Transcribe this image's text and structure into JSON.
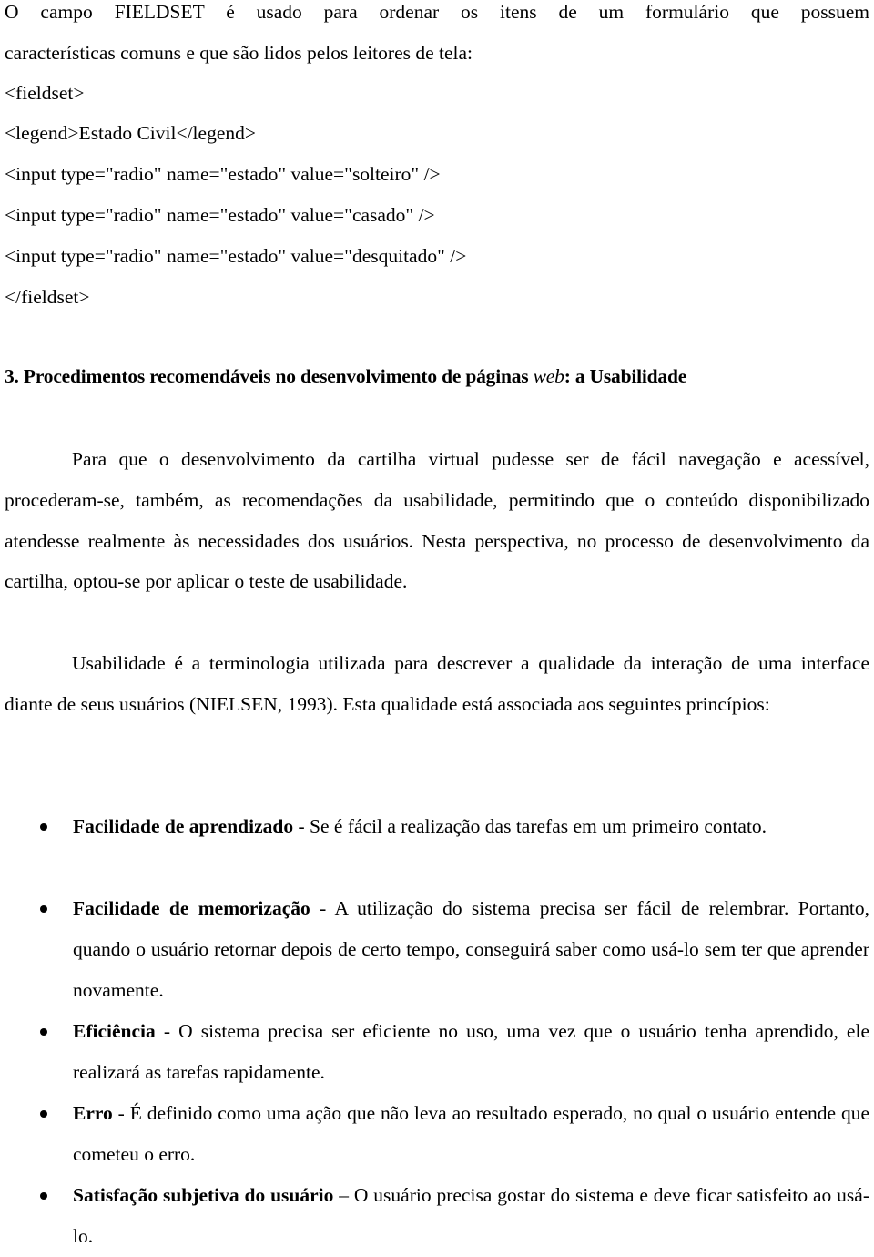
{
  "intro": {
    "line1": "O campo FIELDSET é usado para ordenar os itens de um formulário que possuem",
    "line2": "características comuns e que são lidos pelos leitores de tela:"
  },
  "code": [
    "<fieldset>",
    "<legend>Estado Civil</legend>",
    "<input type=\"radio\" name=\"estado\" value=\"solteiro\" />",
    "<input type=\"radio\" name=\"estado\" value=\"casado\" />",
    "<input type=\"radio\" name=\"estado\" value=\"desquitado\" />",
    "</fieldset>"
  ],
  "section": {
    "number_title": "3. Procedimentos recomendáveis no desenvolvimento de páginas",
    "italic_word": "web",
    "title_tail": ": a Usabilidade"
  },
  "paragraphs": [
    "Para que o desenvolvimento da cartilha virtual pudesse ser de fácil navegação e acessível, procederam-se, também, as recomendações da usabilidade, permitindo que o conteúdo disponibilizado atendesse realmente às necessidades dos usuários. Nesta perspectiva, no processo de desenvolvimento da cartilha, optou-se por aplicar o teste de usabilidade.",
    "Usabilidade é a terminologia utilizada para descrever a qualidade da interação de uma interface diante de seus usuários (NIELSEN, 1993). Esta qualidade está associada aos seguintes princípios:"
  ],
  "principles": [
    {
      "term": "Facilidade de aprendizado",
      "separator": " - ",
      "text": "Se é fácil a realização das tarefas em um primeiro contato."
    },
    {
      "term": "Facilidade de memorização",
      "separator": " - ",
      "text": "A utilização do sistema precisa ser fácil de relembrar. Portanto, quando o usuário retornar depois de certo tempo, conseguirá saber como usá-lo sem ter que aprender novamente."
    },
    {
      "term": "Eficiência",
      "separator": " - ",
      "text": "O sistema precisa ser eficiente no uso, uma vez que o usuário tenha aprendido, ele realizará as tarefas rapidamente."
    },
    {
      "term": "Erro",
      "separator": " - ",
      "text": "É definido como uma ação que não leva ao resultado esperado, no qual o usuário entende que cometeu o erro."
    },
    {
      "term": "Satisfação subjetiva do usuário",
      "separator": " – ",
      "text": "O usuário precisa gostar do sistema e deve ficar satisfeito ao usá-lo."
    }
  ]
}
